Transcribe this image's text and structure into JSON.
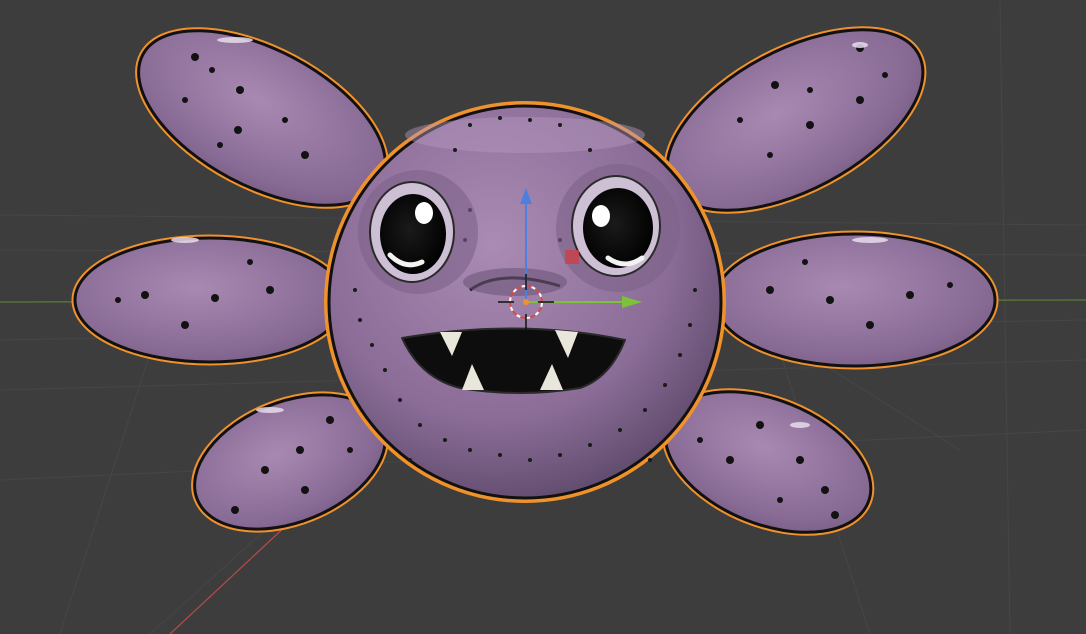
{
  "viewport": {
    "background_color": "#3d3d3d",
    "grid_line_color": "#474747",
    "x_axis_color": "#b44a50",
    "y_axis_color": "#6f9a2c",
    "selection_outline_color": "#f0922c"
  },
  "object": {
    "body_color": "#8e6f9a",
    "body_shadow_color": "#5e4a6a",
    "spot_color": "#121212",
    "mouth_color": "#0d0d0d",
    "tooth_color": "#e9e6dc"
  },
  "gizmo": {
    "z_arrow_color": "#4c7fe0",
    "y_arrow_color": "#7bc43a",
    "x_handle_color": "#c8434a",
    "cursor_color": "#ffffff"
  }
}
